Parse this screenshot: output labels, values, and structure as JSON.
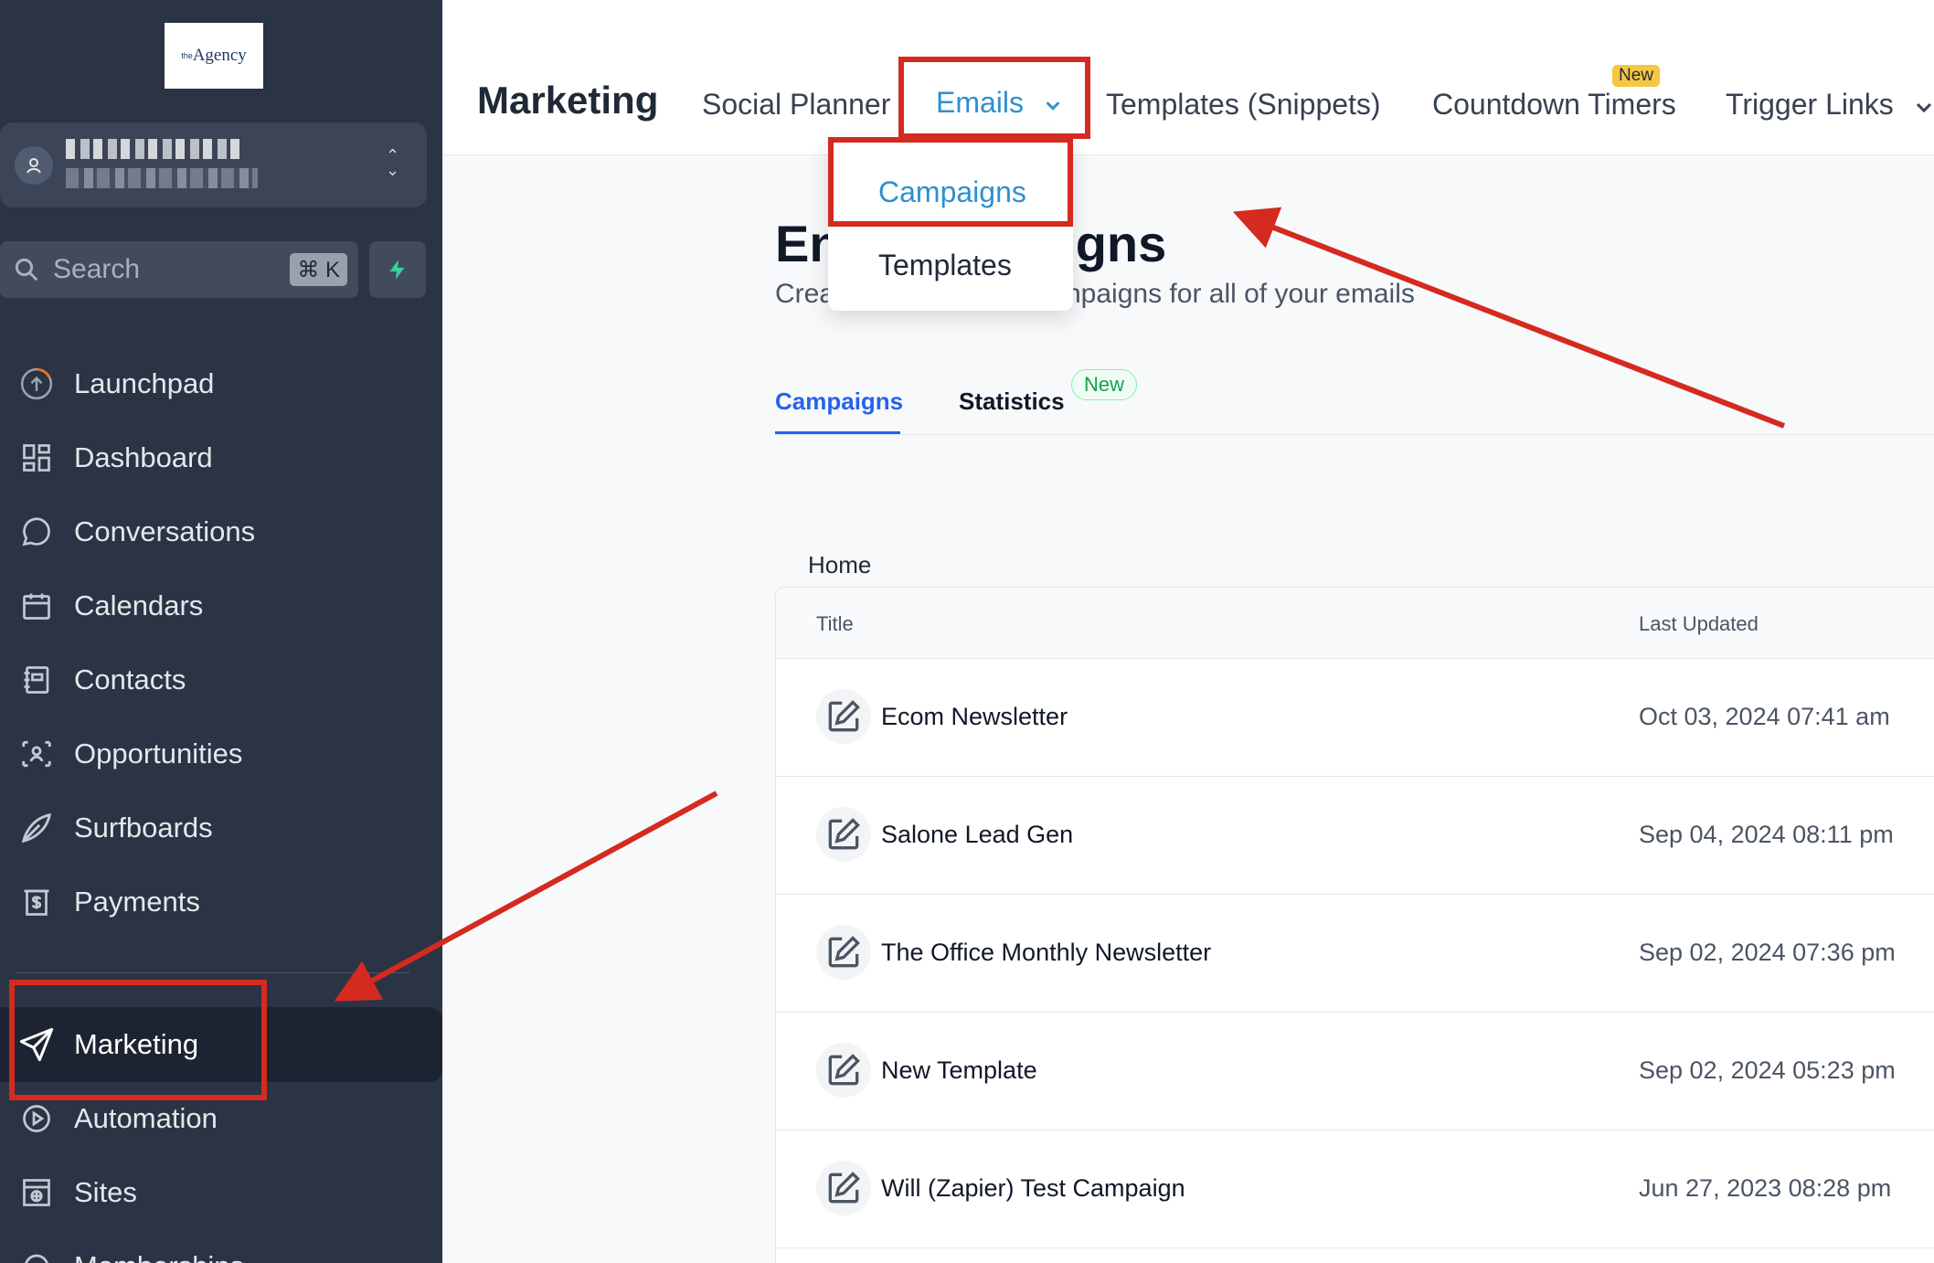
{
  "sidebar": {
    "logo": "Agency",
    "logo_prefix": "the",
    "search_placeholder": "Search",
    "search_shortcut": "⌘ K",
    "items": [
      {
        "label": "Launchpad",
        "icon": "launchpad-icon"
      },
      {
        "label": "Dashboard",
        "icon": "dashboard-icon"
      },
      {
        "label": "Conversations",
        "icon": "chat-icon"
      },
      {
        "label": "Calendars",
        "icon": "calendar-icon"
      },
      {
        "label": "Contacts",
        "icon": "contacts-icon"
      },
      {
        "label": "Opportunities",
        "icon": "opportunities-icon"
      },
      {
        "label": "Surfboards",
        "icon": "surfboard-icon"
      },
      {
        "label": "Payments",
        "icon": "payments-icon"
      },
      {
        "label": "Marketing",
        "icon": "send-icon"
      },
      {
        "label": "Automation",
        "icon": "automation-icon"
      },
      {
        "label": "Sites",
        "icon": "sites-icon"
      },
      {
        "label": "Memberships",
        "icon": "memberships-icon"
      }
    ]
  },
  "topnav": {
    "title": "Marketing",
    "tabs": [
      "Social Planner",
      "Emails",
      "Templates (Snippets)",
      "Countdown Timers",
      "Trigger Links"
    ],
    "new_badge": "New",
    "dropdown": [
      "Campaigns",
      "Templates"
    ]
  },
  "main": {
    "heading_left": "En",
    "heading_right": "aigns",
    "subheading_left": "Crea",
    "subheading_right": "npaigns for all of your emails",
    "subtabs": [
      "Campaigns",
      "Statistics"
    ],
    "statistics_badge": "New",
    "breadcrumb": "Home",
    "columns": [
      "Title",
      "Last Updated"
    ],
    "rows": [
      {
        "title": "Ecom Newsletter",
        "updated": "Oct 03, 2024 07:41 am"
      },
      {
        "title": "Salone Lead Gen",
        "updated": "Sep 04, 2024 08:11 pm"
      },
      {
        "title": "The Office Monthly Newsletter",
        "updated": "Sep 02, 2024 07:36 pm"
      },
      {
        "title": "New Template",
        "updated": "Sep 02, 2024 05:23 pm"
      },
      {
        "title": "Will (Zapier) Test Campaign",
        "updated": "Jun 27, 2023 08:28 pm"
      }
    ]
  },
  "colors": {
    "sidebar_bg": "#2b3445",
    "accent_blue": "#2e8fd0",
    "annotation_red": "#d42a1f"
  }
}
